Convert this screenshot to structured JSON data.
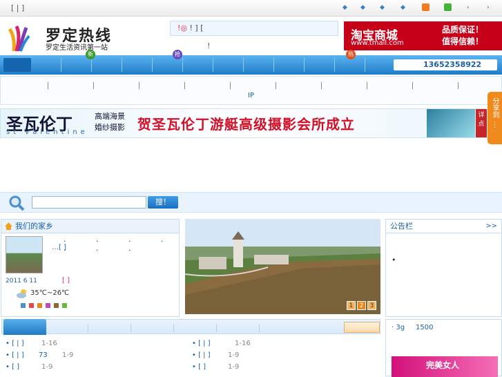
{
  "topbar": {
    "left_text": "[ | ]"
  },
  "brand": {
    "logo_title": "罗定热线",
    "logo_subtitle": "罗定生活资讯第一站"
  },
  "notice": {
    "warn_mark": "!◎",
    "text": "! ] [",
    "sub": "!"
  },
  "tmall": {
    "title": "淘宝商城",
    "url": "www.tmall.com",
    "slogan_1": "品质保证！",
    "slogan_2": "值得信赖！"
  },
  "nav": {
    "badges": [
      {
        "text": "新",
        "color": "#3a9b2a"
      },
      {
        "text": "抢",
        "color": "#6a4bc4"
      },
      {
        "text": "热",
        "color": "#e2521d"
      }
    ],
    "phone": "13652358922"
  },
  "subnav": {
    "ip_label": "IP"
  },
  "banner": {
    "brand": "圣瓦伦丁",
    "sub_1": "高端海景",
    "sub_2": "婚纱摄影",
    "english": "st valentine",
    "slogan": "贺圣瓦伦丁游艇高级摄影会所成立",
    "detail": "详点"
  },
  "share": {
    "label": "分享到"
  },
  "search": {
    "value": "",
    "button": "搜！"
  },
  "hometown": {
    "title": "我们的家乡",
    "dots": ". . . . . . .",
    "more": "…[ ]",
    "date": "2011 6 11",
    "bracket": "[ ]",
    "temperature": "35℃~26℃"
  },
  "photo": {
    "pages": [
      "1",
      "2",
      "3"
    ]
  },
  "board": {
    "title": "公告栏",
    "more": ">>",
    "item": "•"
  },
  "list_left": [
    {
      "text": "• [ | ]",
      "extra": "",
      "range": "1-16"
    },
    {
      "text": "• [ | ]",
      "extra": "73",
      "range": "1-9"
    },
    {
      "text": "• [ ]",
      "extra": "",
      "range": "1-9"
    }
  ],
  "list_right": [
    {
      "text": "• [ | ]",
      "range": "1-16"
    },
    {
      "text": "• [ | ]",
      "range": "1-9"
    },
    {
      "text": "• [ ]",
      "range": "1-9"
    }
  ],
  "rside": {
    "line_1": "3g",
    "line_1_num": "1500",
    "ad_text": "完美女人"
  }
}
